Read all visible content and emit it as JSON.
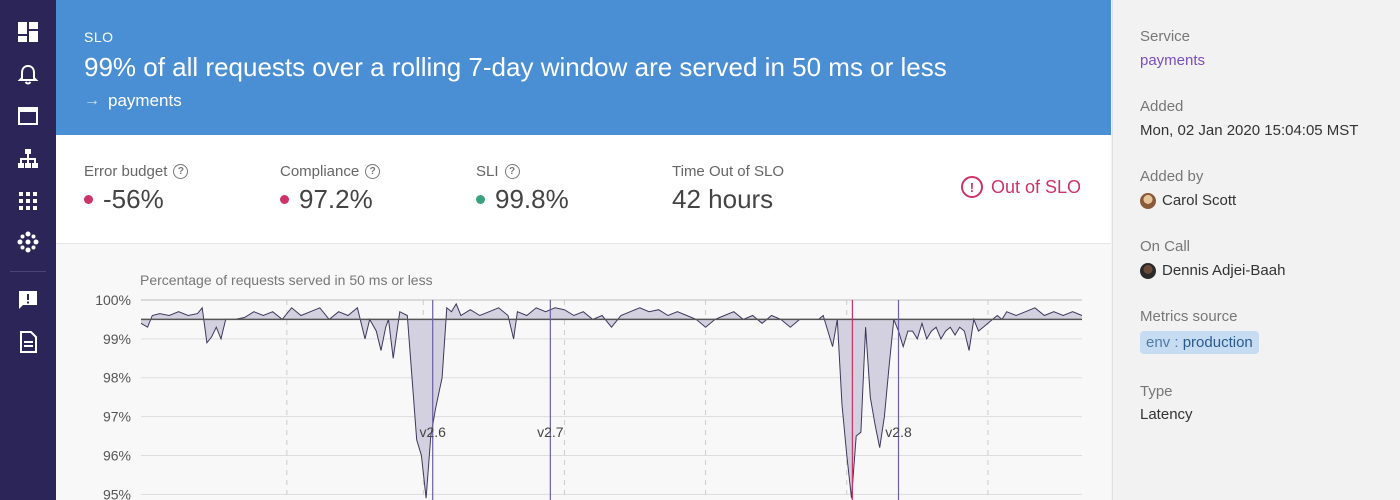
{
  "nav": {
    "items": [
      {
        "icon": "dashboard-icon"
      },
      {
        "icon": "bell-icon"
      },
      {
        "icon": "window-icon"
      },
      {
        "icon": "hierarchy-icon"
      },
      {
        "icon": "grid-icon"
      },
      {
        "icon": "cluster-icon"
      },
      {
        "icon": "alert-message-icon"
      },
      {
        "icon": "document-icon"
      }
    ]
  },
  "header": {
    "label": "SLO",
    "title": "99% of all requests over a rolling 7-day window are served in 50 ms or less",
    "service_link": "payments"
  },
  "metrics": {
    "error_budget": {
      "label": "Error budget",
      "value": "-56%",
      "color": "#cc3366"
    },
    "compliance": {
      "label": "Compliance",
      "value": "97.2%",
      "color": "#cc3366"
    },
    "sli": {
      "label": "SLI",
      "value": "99.8%",
      "color": "#3aa17e"
    },
    "time_out": {
      "label": "Time Out of SLO",
      "value": "42 hours"
    },
    "status": "Out of SLO"
  },
  "chart_data": {
    "type": "area",
    "title": "Percentage of requests served in 50 ms or less",
    "ylabel": "",
    "xlabel": "",
    "ylim": [
      94.7,
      100
    ],
    "xlim": [
      0,
      100
    ],
    "yticks": [
      "100%",
      "99%",
      "98%",
      "97%",
      "96%",
      "95%"
    ],
    "ytick_values": [
      100,
      99,
      98,
      97,
      96,
      95
    ],
    "target": 99.5,
    "grid": true,
    "series": [
      {
        "values": [
          [
            0,
            99.4
          ],
          [
            0.7,
            99.3
          ],
          [
            1.2,
            99.6
          ],
          [
            2,
            99.65
          ],
          [
            3,
            99.6
          ],
          [
            4,
            99.7
          ],
          [
            5,
            99.6
          ],
          [
            6,
            99.65
          ],
          [
            6.5,
            99.8
          ],
          [
            7,
            98.9
          ],
          [
            7.5,
            99.05
          ],
          [
            8,
            99.3
          ],
          [
            8.5,
            99.0
          ],
          [
            9,
            99.5
          ],
          [
            10,
            99.5
          ],
          [
            11,
            99.55
          ],
          [
            12,
            99.7
          ],
          [
            13,
            99.6
          ],
          [
            14,
            99.7
          ],
          [
            15,
            99.5
          ],
          [
            16,
            99.8
          ],
          [
            17,
            99.6
          ],
          [
            18,
            99.7
          ],
          [
            19,
            99.8
          ],
          [
            20,
            99.5
          ],
          [
            21,
            99.7
          ],
          [
            22,
            99.6
          ],
          [
            23,
            99.8
          ],
          [
            23.8,
            99.0
          ],
          [
            24.3,
            99.5
          ],
          [
            25,
            99.2
          ],
          [
            25.5,
            98.7
          ],
          [
            26,
            99.3
          ],
          [
            26.3,
            99.5
          ],
          [
            26.8,
            98.5
          ],
          [
            27.5,
            99.7
          ],
          [
            28.3,
            99.6
          ],
          [
            28.8,
            98.0
          ],
          [
            29.3,
            96.4
          ],
          [
            29.8,
            96.0
          ],
          [
            30.3,
            94.9
          ],
          [
            30.8,
            96.5
          ],
          [
            31.3,
            97.2
          ],
          [
            32,
            98.0
          ],
          [
            32.5,
            99.8
          ],
          [
            33,
            99.7
          ],
          [
            33.5,
            99.9
          ],
          [
            34,
            99.6
          ],
          [
            35,
            99.75
          ],
          [
            36,
            99.6
          ],
          [
            37,
            99.7
          ],
          [
            38,
            99.8
          ],
          [
            39,
            99.6
          ],
          [
            39.6,
            99.0
          ],
          [
            40,
            99.7
          ],
          [
            41,
            99.6
          ],
          [
            42,
            99.8
          ],
          [
            43,
            99.7
          ],
          [
            44,
            99.8
          ],
          [
            45,
            99.75
          ],
          [
            46,
            99.6
          ],
          [
            47,
            99.7
          ],
          [
            48,
            99.5
          ],
          [
            49,
            99.6
          ],
          [
            50,
            99.3
          ],
          [
            51,
            99.6
          ],
          [
            52,
            99.7
          ],
          [
            53,
            99.8
          ],
          [
            54,
            99.7
          ],
          [
            55,
            99.75
          ],
          [
            56,
            99.6
          ],
          [
            57,
            99.7
          ],
          [
            58,
            99.6
          ],
          [
            59,
            99.5
          ],
          [
            60,
            99.3
          ],
          [
            61,
            99.5
          ],
          [
            62,
            99.6
          ],
          [
            63,
            99.7
          ],
          [
            64,
            99.5
          ],
          [
            65,
            99.6
          ],
          [
            66,
            99.4
          ],
          [
            67,
            99.6
          ],
          [
            68,
            99.5
          ],
          [
            69,
            99.3
          ],
          [
            70,
            99.5
          ],
          [
            71,
            99.5
          ],
          [
            72,
            99.5
          ],
          [
            72.5,
            99.6
          ],
          [
            73,
            99.2
          ],
          [
            73.5,
            98.8
          ],
          [
            74,
            99.5
          ],
          [
            74.5,
            97.3
          ],
          [
            75,
            96.0
          ],
          [
            75.5,
            94.9
          ],
          [
            76,
            96.5
          ],
          [
            76.5,
            96.6
          ],
          [
            77,
            99.3
          ],
          [
            77.5,
            97.5
          ],
          [
            78,
            96.8
          ],
          [
            78.5,
            96.2
          ],
          [
            79,
            97.0
          ],
          [
            79.5,
            98.3
          ],
          [
            80,
            99.5
          ],
          [
            80.5,
            99.2
          ],
          [
            81,
            98.8
          ],
          [
            81.5,
            99.2
          ],
          [
            82,
            99.2
          ],
          [
            82.5,
            99.0
          ],
          [
            83,
            99.4
          ],
          [
            83.5,
            99.0
          ],
          [
            84,
            99.2
          ],
          [
            84.5,
            99.3
          ],
          [
            85,
            99.0
          ],
          [
            85.5,
            99.2
          ],
          [
            86,
            99.3
          ],
          [
            86.5,
            99.1
          ],
          [
            87,
            99.3
          ],
          [
            87.5,
            99.2
          ],
          [
            88,
            98.7
          ],
          [
            88.5,
            99.5
          ],
          [
            89,
            99.2
          ],
          [
            89.5,
            99.3
          ],
          [
            90,
            99.4
          ],
          [
            90.5,
            99.5
          ],
          [
            91,
            99.6
          ],
          [
            91.5,
            99.5
          ],
          [
            92,
            99.7
          ],
          [
            93,
            99.6
          ],
          [
            94,
            99.7
          ],
          [
            95,
            99.8
          ],
          [
            96,
            99.6
          ],
          [
            97,
            99.7
          ],
          [
            98,
            99.6
          ],
          [
            99,
            99.7
          ],
          [
            100,
            99.6
          ]
        ]
      }
    ],
    "deploy_markers": [
      {
        "label": "v2.6",
        "x": 31.0
      },
      {
        "label": "v2.7",
        "x": 43.5
      },
      {
        "label": "v2.8",
        "x": 80.5
      }
    ],
    "alert_marker_x": 75.6,
    "dashed_gridlines_x": [
      15.5,
      30.0,
      45.0,
      60.0,
      75.0,
      90.0
    ],
    "colors": {
      "fill": "#d3d1e0",
      "line": "#3c385c",
      "target": "#555",
      "deploy": "#6b5fa6",
      "alert": "#cc3366"
    }
  },
  "sidebar": {
    "service_label": "Service",
    "service_value": "payments",
    "added_label": "Added",
    "added_value": "Mon, 02 Jan 2020 15:04:05 MST",
    "added_by_label": "Added by",
    "added_by_value": "Carol Scott",
    "on_call_label": "On Call",
    "on_call_value": "Dennis Adjei-Baah",
    "metrics_source_label": "Metrics source",
    "metrics_source_key": "env",
    "metrics_source_sep": ":",
    "metrics_source_value": "production",
    "type_label": "Type",
    "type_value": "Latency"
  }
}
